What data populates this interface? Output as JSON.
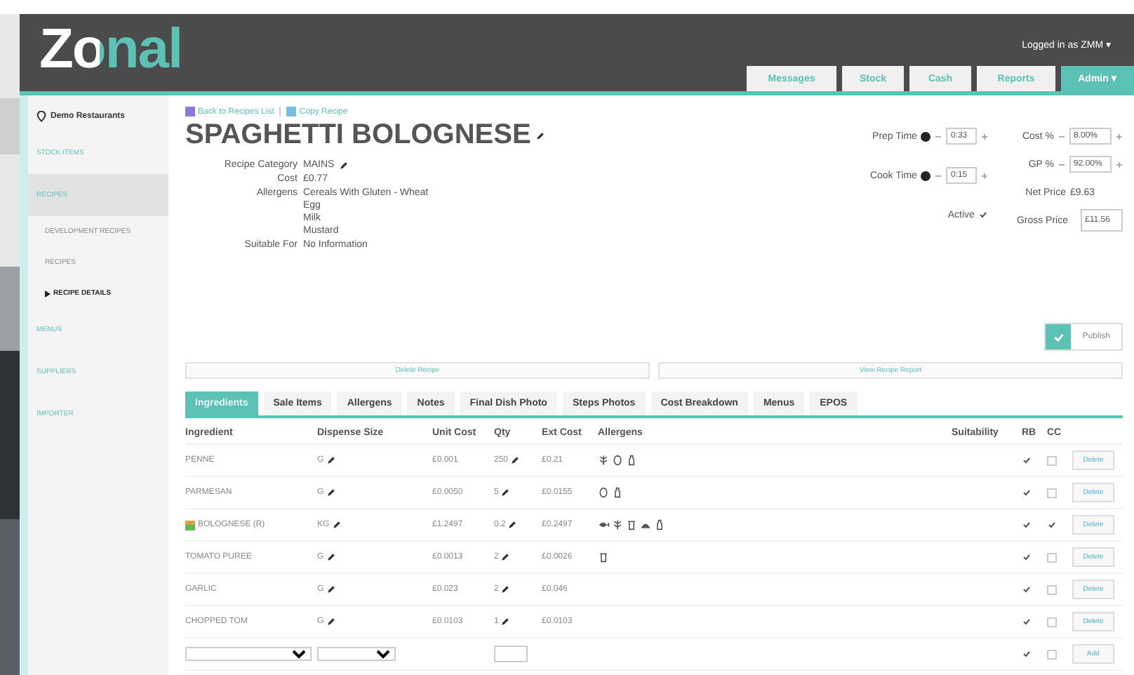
{
  "header": {
    "logo": "Zonal",
    "user": "Logged in as ZMM ▾",
    "nav": [
      {
        "label": "Messages",
        "selected": false
      },
      {
        "label": "Stock",
        "selected": false
      },
      {
        "label": "Cash",
        "selected": false
      },
      {
        "label": "Reports",
        "selected": false
      },
      {
        "label": "Admin ▾",
        "selected": true
      }
    ]
  },
  "sidebar": {
    "site": "Demo Restaurants",
    "items": [
      {
        "label": "STOCK ITEMS",
        "selected": false
      },
      {
        "label": "RECIPES",
        "selected": true,
        "children": [
          {
            "label": "DEVELOPMENT RECIPES",
            "selected": false
          },
          {
            "label": "RECIPES",
            "selected": false
          },
          {
            "label": "RECIPE DETAILS",
            "selected": true
          }
        ]
      },
      {
        "label": "MENUS",
        "selected": false
      },
      {
        "label": "SUPPLIERS",
        "selected": false
      },
      {
        "label": "IMPORTER",
        "selected": false
      }
    ]
  },
  "links": [
    "Back to Recipes List",
    "Copy Recipe"
  ],
  "title": "SPAGHETTI BOLOGNESE",
  "details": [
    {
      "label": "Recipe Category",
      "values": [
        "MAINS"
      ],
      "editable": true
    },
    {
      "label": "Cost",
      "values": [
        "£0.77"
      ],
      "editable": false
    },
    {
      "label": "Allergens",
      "values": [
        "Cereals With Gluten - Wheat",
        "Egg",
        "Milk",
        "Mustard"
      ],
      "editable": false
    },
    {
      "label": "Suitable For",
      "values": [
        "No Information"
      ],
      "editable": false
    }
  ],
  "times": [
    {
      "label": "Prep Time",
      "value": "0:33"
    },
    {
      "label": "Cook Time",
      "value": "0:15"
    }
  ],
  "active": {
    "label": "Active",
    "checked": true
  },
  "prices": [
    {
      "kind": "input",
      "label": "Cost %",
      "value": "8.00%"
    },
    {
      "kind": "input",
      "label": "GP %",
      "value": "92.00%"
    },
    {
      "kind": "text",
      "label": "Net Price",
      "value": "£9.63"
    },
    {
      "kind": "box",
      "label": "Gross Price",
      "value": "£11.56"
    }
  ],
  "publish": "Publish",
  "actions": [
    "Delete Recipe",
    "View Recipe Report"
  ],
  "tabs": [
    {
      "label": "Ingredients",
      "selected": true
    },
    {
      "label": "Sale Items",
      "selected": false
    },
    {
      "label": "Allergens",
      "selected": false
    },
    {
      "label": "Notes",
      "selected": false
    },
    {
      "label": "Final Dish Photo",
      "selected": false
    },
    {
      "label": "Steps Photos",
      "selected": false
    },
    {
      "label": "Cost Breakdown",
      "selected": false
    },
    {
      "label": "Menus",
      "selected": false
    },
    {
      "label": "EPOS",
      "selected": false
    }
  ],
  "table": {
    "columns": [
      "Ingredient",
      "Dispense Size",
      "Unit Cost",
      "Qty",
      "Ext Cost",
      "Allergens",
      "Suitability",
      "RB",
      "CC"
    ],
    "rows": [
      {
        "ingredient": "PENNE",
        "recipe": false,
        "dispense": "G",
        "unit_cost": "£0.001",
        "qty": "250",
        "ext_cost": "£0.21",
        "allergens": [
          {
            "kind": "grain"
          },
          {
            "kind": "egg"
          },
          {
            "kind": "bottle"
          }
        ],
        "rb": true,
        "cc": false,
        "action": "Delete"
      },
      {
        "ingredient": "PARMESAN",
        "recipe": false,
        "dispense": "G",
        "unit_cost": "£0.0050",
        "qty": "5",
        "ext_cost": "£0.0155",
        "allergens": [
          {
            "kind": "egg"
          },
          {
            "kind": "bottle"
          }
        ],
        "rb": true,
        "cc": false,
        "action": "Delete"
      },
      {
        "ingredient": "BOLOGNESE (R)",
        "recipe": true,
        "dispense": "KG",
        "unit_cost": "£1.2497",
        "qty": "0.2",
        "ext_cost": "£0.2497",
        "allergens": [
          {
            "kind": "fish"
          },
          {
            "kind": "grain"
          },
          {
            "kind": "jar"
          },
          {
            "kind": "shell"
          },
          {
            "kind": "bottle"
          }
        ],
        "rb": true,
        "cc": true,
        "action": "Delete"
      },
      {
        "ingredient": "TOMATO PUREE",
        "recipe": false,
        "dispense": "G",
        "unit_cost": "£0.0013",
        "qty": "2",
        "ext_cost": "£0.0026",
        "allergens": [
          {
            "kind": "jar"
          }
        ],
        "rb": true,
        "cc": false,
        "action": "Delete"
      },
      {
        "ingredient": "GARLIC",
        "recipe": false,
        "dispense": "G",
        "unit_cost": "£0.023",
        "qty": "2",
        "ext_cost": "£0.046",
        "rb": true,
        "cc": false,
        "action": "Delete"
      },
      {
        "ingredient": "CHOPPED TOM",
        "recipe": false,
        "dispense": "G",
        "unit_cost": "£0.0103",
        "qty": "1",
        "ext_cost": "£0.0103",
        "rb": true,
        "cc": false,
        "action": "Delete"
      }
    ],
    "new_row": {
      "rb": true,
      "cc": false,
      "action": "Add"
    }
  }
}
